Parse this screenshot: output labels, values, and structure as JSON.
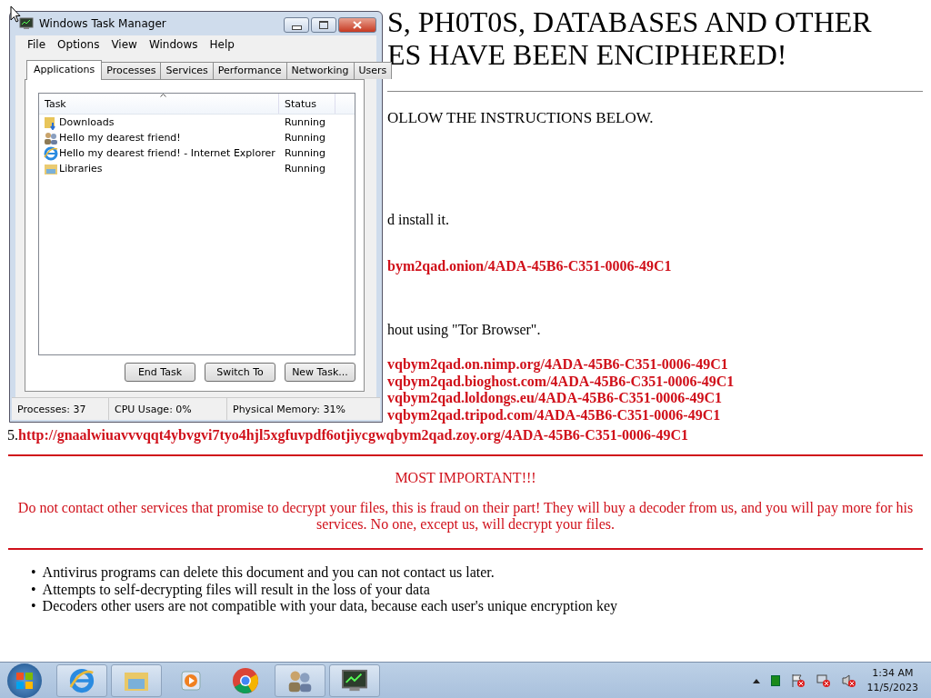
{
  "note": {
    "heading_lines": [
      "S, PH0T0S, DATABASES AND OTHER",
      "ES HAVE BEEN ENCIPHERED!"
    ],
    "instruction": "OLLOW THE INSTRUCTIONS BELOW.",
    "install_text": "d install it.",
    "onion_link": "bym2qad.onion/4ADA-45B6-C351-0006-49C1",
    "tor_text": "hout using \"Tor Browser\".",
    "mirror_links": [
      "vqbym2qad.on.nimp.org/4ADA-45B6-C351-0006-49C1",
      "vqbym2qad.bioghost.com/4ADA-45B6-C351-0006-49C1",
      "vqbym2qad.loldongs.eu/4ADA-45B6-C351-0006-49C1",
      "vqbym2qad.tripod.com/4ADA-45B6-C351-0006-49C1"
    ],
    "last_mirror": {
      "number": "5.",
      "link": "http://gnaalwiuavvvqqt4ybvgvi7tyo4hjl5xgfuvpdf6otjiycgwqbym2qad.zoy.org/4ADA-45B6-C351-0006-49C1"
    },
    "important_title": "MOST IMPORTANT!!!",
    "important_text": "Do not contact other services that promise to decrypt your files, this is fraud on their part! They will buy a decoder from us, and you will pay more for his services. No one, except us, will decrypt your files.",
    "bullets": [
      {
        "marker": "•",
        "text": "Antivirus programs can delete this document and you can not contact us later."
      },
      {
        "marker": "•",
        "text": "Attempts to self-decrypting files will result in the loss of your data"
      },
      {
        "marker": "•",
        "text": "Decoders other users are not compatible with your data, because each user's unique encryption key"
      }
    ]
  },
  "task_manager": {
    "title": "Windows Task Manager",
    "menu": [
      "File",
      "Options",
      "View",
      "Windows",
      "Help"
    ],
    "tabs": [
      {
        "label": "Applications",
        "selected": true
      },
      {
        "label": "Processes",
        "selected": false
      },
      {
        "label": "Services",
        "selected": false
      },
      {
        "label": "Performance",
        "selected": false
      },
      {
        "label": "Networking",
        "selected": false
      },
      {
        "label": "Users",
        "selected": false
      }
    ],
    "columns": [
      "Task",
      "Status"
    ],
    "rows": [
      {
        "task": "Downloads",
        "status": "Running"
      },
      {
        "task": "Hello my dearest friend!",
        "status": "Running"
      },
      {
        "task": "Hello my dearest friend! - Internet Explorer",
        "status": "Running"
      },
      {
        "task": "Libraries",
        "status": "Running"
      }
    ],
    "buttons": [
      "End Task",
      "Switch To",
      "New Task..."
    ],
    "status_bar": [
      "Processes: 37",
      "CPU Usage: 0%",
      "Physical Memory: 31%"
    ]
  },
  "taskbar": {
    "time": "1:34 AM",
    "date": "11/5/2023"
  }
}
